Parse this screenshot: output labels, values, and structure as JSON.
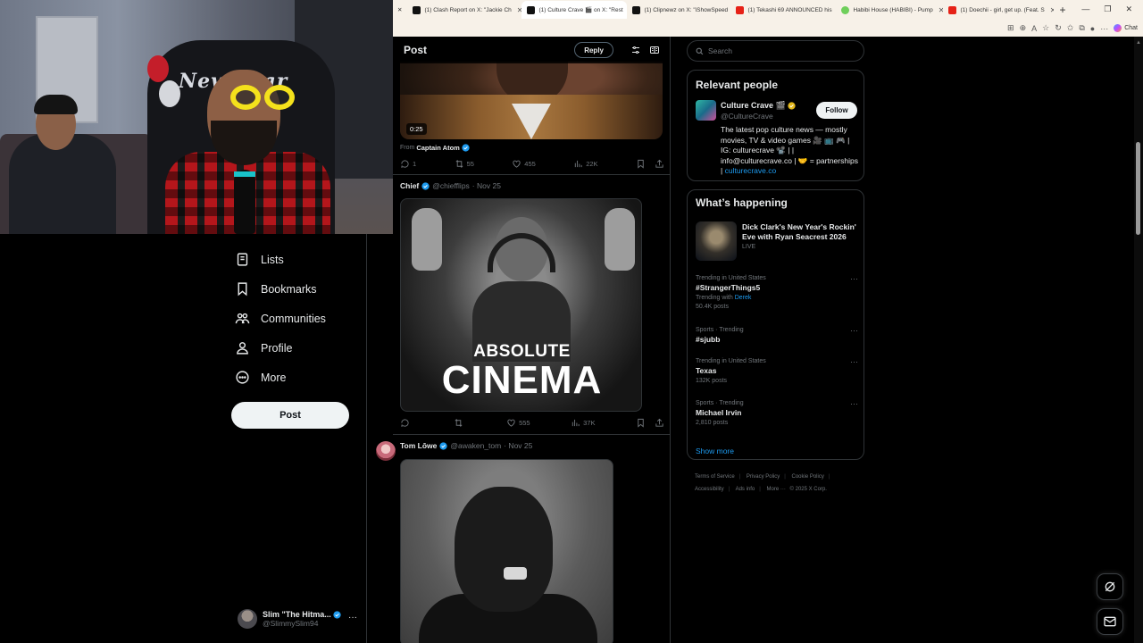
{
  "browser": {
    "tabs": [
      {
        "label": "(1) Clash Report on X: \"Jackie Ch",
        "fav_color": "#111111"
      },
      {
        "label": "(1) Culture Crave 🎬 on X: \"Rest",
        "fav_color": "#111111"
      },
      {
        "label": "(1) Clipnewz on X: \"iShowSpeed",
        "fav_color": "#111111"
      },
      {
        "label": "(1) Tekashi 69 ANNOUNCED his",
        "fav_color": "#e62117"
      },
      {
        "label": "Habibi House (HABIBI) - Pump",
        "fav_color": "#6fcf5b"
      },
      {
        "label": "(1) Doechii - girl, get up. (Feat. S",
        "fav_color": "#e62117"
      }
    ],
    "new_tab": "+",
    "chat_label": "Chat"
  },
  "nav": {
    "items": [
      {
        "label": "Lists",
        "icon": "list-icon"
      },
      {
        "label": "Bookmarks",
        "icon": "bookmark-icon"
      },
      {
        "label": "Communities",
        "icon": "communities-icon"
      },
      {
        "label": "Profile",
        "icon": "profile-icon"
      },
      {
        "label": "More",
        "icon": "more-circle-icon"
      }
    ],
    "post_button": "Post",
    "account": {
      "name": "Slim \"The Hitma...",
      "handle": "@SlimmySlim94"
    }
  },
  "header": {
    "title": "Post",
    "reply_button": "Reply"
  },
  "posts": [
    {
      "video_time": "0:25",
      "from_prefix": "From",
      "from_name": "Captain Atom",
      "replies": "1",
      "reposts": "55",
      "likes": "455",
      "views": "22K"
    },
    {
      "name": "Chief",
      "handle": "@chiefflips",
      "date": "· Nov 25",
      "image_line1": "ABSOLUTE",
      "image_line2": "CINEMA",
      "replies": "",
      "reposts": "",
      "likes": "555",
      "views": "37K"
    },
    {
      "name": "Tom Lōwe",
      "handle": "@awaken_tom",
      "date": "· Nov 25"
    }
  ],
  "right": {
    "search_placeholder": "Search",
    "relevant": {
      "title": "Relevant people",
      "name": "Culture Crave 🎬",
      "handle": "@CultureCrave",
      "follow": "Follow",
      "bio": "The latest pop culture news — mostly movies, TV & video games 🎥 📺 🎮 | IG: culturecrave 📽️ | | info@culturecrave.co | 🤝 = partnerships |",
      "bio_link": "culturecrave.co"
    },
    "happening": {
      "title": "What’s happening",
      "hero_title": "Dick Clark's New Year's Rockin' Eve with Ryan Seacrest 2026",
      "hero_status": "LIVE",
      "trends": [
        {
          "meta": "Trending in United States",
          "topic": "#StrangerThings5",
          "sub_prefix": "Trending with",
          "sub_link": "Derek",
          "posts": "50.4K posts"
        },
        {
          "meta": "Sports · Trending",
          "topic": "#sjubb",
          "sub_prefix": "",
          "sub_link": "",
          "posts": ""
        },
        {
          "meta": "Trending in United States",
          "topic": "Texas",
          "sub_prefix": "",
          "sub_link": "",
          "posts": "132K posts"
        },
        {
          "meta": "Sports · Trending",
          "topic": "Michael Irvin",
          "sub_prefix": "",
          "sub_link": "",
          "posts": "2,810 posts"
        }
      ],
      "show_more": "Show more"
    },
    "footer": {
      "terms": "Terms of Service",
      "privacy": "Privacy Policy",
      "cookie": "Cookie Policy",
      "accessibility": "Accessibility",
      "ads": "Ads info",
      "more": "More ···",
      "copyright": "© 2025 X Corp."
    }
  },
  "webcam": {
    "overlay_text": "New Year"
  },
  "colors": {
    "accent": "#1d9bf0",
    "background": "#000000",
    "border": "#2f3336",
    "muted": "#71767b"
  }
}
